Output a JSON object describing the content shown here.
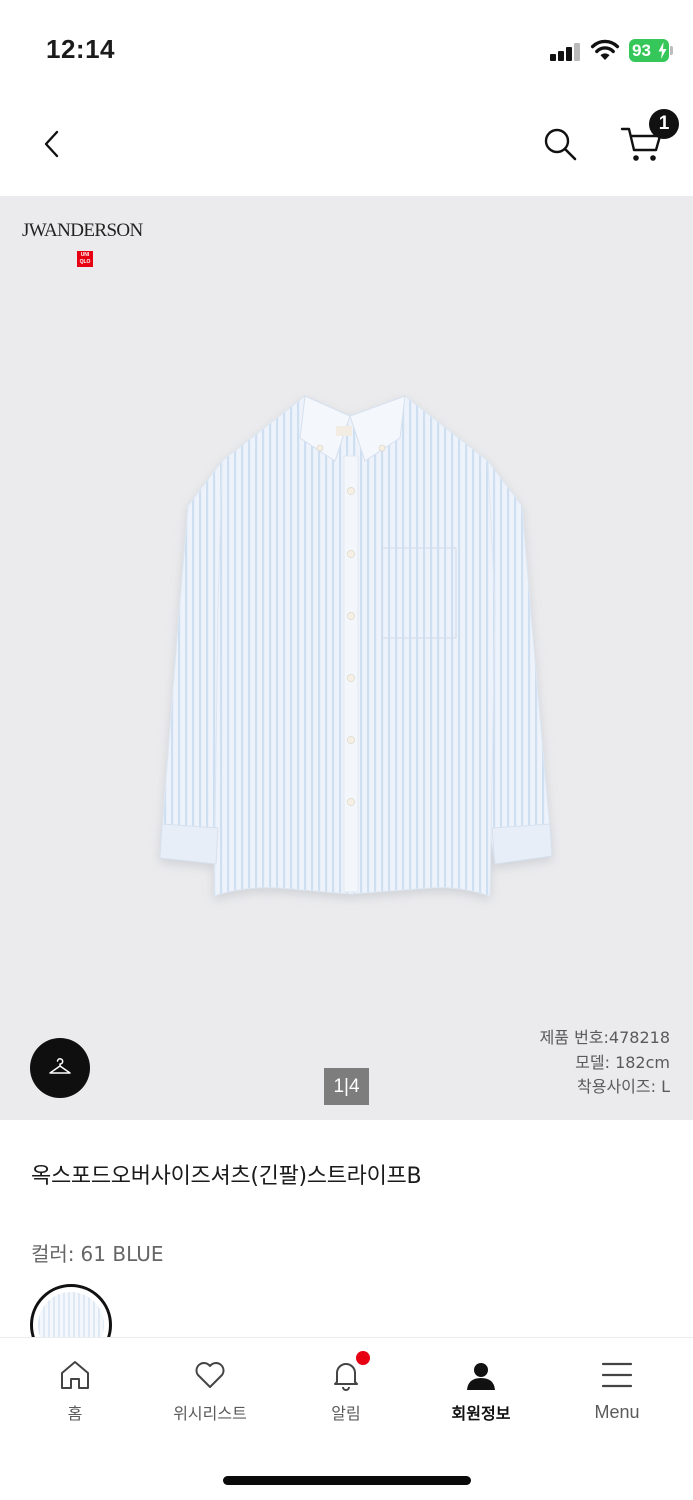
{
  "status": {
    "time": "12:14",
    "battery": "93"
  },
  "header": {
    "cart_count": "1"
  },
  "image": {
    "brand_name": "JWANDERSON",
    "brand_logo_text": "UNI QLO",
    "page_indicator": "1|4",
    "product_number": "제품 번호:478218",
    "model_height": "모델: 182cm",
    "worn_size": "착용사이즈: L"
  },
  "product": {
    "title": "옥스포드오버사이즈셔츠(긴팔)스트라이프B",
    "color_label": "컬러:",
    "color_value": "61 BLUE",
    "swatch_color": "#dfe9f6"
  },
  "tabs": [
    {
      "label": "홈",
      "icon": "home-icon"
    },
    {
      "label": "위시리스트",
      "icon": "heart-icon"
    },
    {
      "label": "알림",
      "icon": "bell-icon"
    },
    {
      "label": "회원정보",
      "icon": "user-icon"
    },
    {
      "label": "Menu",
      "icon": "menu-icon"
    }
  ],
  "colors": {
    "accent_red": "#e60012",
    "battery_green": "#35c759"
  }
}
